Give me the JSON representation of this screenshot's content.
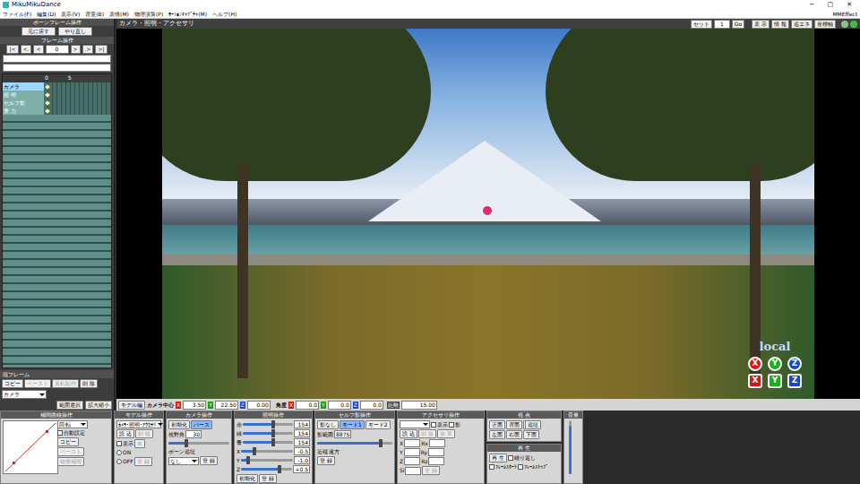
{
  "window": {
    "title": "MikuMikuDance",
    "controls": [
      "─",
      "▢",
      "✕"
    ]
  },
  "menu": {
    "items": [
      "ファイル(F)",
      "編集(D)",
      "表示(V)",
      "背景(B)",
      "表情(M)",
      "物理演算(P)",
      "ﾓｰｼｮﾝｷｬﾌﾟﾁｬ(M)",
      "ヘルプ(H)"
    ],
    "right": "MMEffect"
  },
  "frame_panel": {
    "title": "ボーンフレーム操作",
    "undo": "元に戻す",
    "redo": "やり直し",
    "nav_title": "フレーム操作",
    "nav": [
      "|<",
      "<.",
      "<"
    ],
    "frame": "0",
    "nav_next": [
      ">",
      ".>",
      ">|"
    ],
    "ruler": [
      "0",
      "5"
    ],
    "tracks": [
      {
        "name": "カメラ",
        "selected": true,
        "keyframe": true
      },
      {
        "name": "照 明",
        "selected": false,
        "keyframe": true
      },
      {
        "name": "セルフ影",
        "selected": false,
        "keyframe": true
      },
      {
        "name": "重 力",
        "selected": false,
        "keyframe": true
      }
    ],
    "current_frame": "現フレーム",
    "edit_buttons": [
      {
        "label": "コピー",
        "disabled": false
      },
      {
        "label": "ペースト",
        "disabled": true
      },
      {
        "label": "反転貼付",
        "disabled": true
      },
      {
        "label": "削 除",
        "disabled": false
      }
    ],
    "target": "カメラ",
    "range_buttons": [
      "範囲選択",
      "拡大縮小"
    ]
  },
  "viewport": {
    "title": "カメラ・照明・アクセサリ",
    "set_label": "セット",
    "set_value": "1",
    "go": "Go",
    "tools": [
      "表 示",
      "情 報",
      "追エネ",
      "座標軸"
    ],
    "axis_mode": "local",
    "axis_rows": [
      {
        "kind": "rotate",
        "axes": [
          {
            "label": "X",
            "color": "#d01818"
          },
          {
            "label": "Y",
            "color": "#18b018"
          },
          {
            "label": "Z",
            "color": "#1848d0"
          }
        ]
      },
      {
        "kind": "move",
        "axes": [
          {
            "label": "X",
            "color": "#d01818"
          },
          {
            "label": "Y",
            "color": "#18b018"
          },
          {
            "label": "Z",
            "color": "#1848d0"
          }
        ]
      }
    ]
  },
  "status": {
    "mode": "モデル編",
    "center_label": "カメラ中心",
    "center": [
      {
        "axis": "X",
        "value": "3.50",
        "color": "#d01818"
      },
      {
        "axis": "Y",
        "value": "22.50",
        "color": "#18a018"
      },
      {
        "axis": "Z",
        "value": "0.00",
        "color": "#1848d0"
      }
    ],
    "angle_label": "角度",
    "angle": [
      {
        "axis": "X",
        "value": "0.0",
        "color": "#d01818"
      },
      {
        "axis": "Y",
        "value": "0.0",
        "color": "#18a018"
      },
      {
        "axis": "Z",
        "value": "0.0",
        "color": "#1848d0"
      }
    ],
    "distance_label": "距離",
    "distance": "15.00"
  },
  "panels": [
    {
      "title": "補間曲線操作",
      "columns": [
        [
          [
            {
              "kind": "curve"
            }
          ]
        ],
        [
          [
            {
              "kind": "select",
              "text": "回 転"
            }
          ],
          [
            {
              "kind": "check",
              "text": "自動設定",
              "checked": false
            }
          ],
          [
            {
              "kind": "button",
              "text": "コピー",
              "disabled": false
            }
          ],
          [
            {
              "kind": "button",
              "text": "ペースト",
              "disabled": true
            }
          ],
          [
            {
              "kind": "button",
              "text": "線形補間",
              "disabled": true
            }
          ]
        ]
      ]
    },
    {
      "title": "モデル操作",
      "columns": [
        [
          [
            {
              "kind": "select",
              "text": "ｶﾒﾗ･照明･ｱｸｾｻﾘ"
            }
          ],
          [
            {
              "kind": "button",
              "text": "読 込",
              "disabled": false
            },
            {
              "kind": "button",
              "text": "削 除",
              "disabled": true
            }
          ],
          [
            {
              "kind": "check",
              "text": "表示",
              "checked": false
            },
            {
              "kind": "button",
              "text": "IK",
              "disabled": true
            }
          ],
          [
            {
              "kind": "radio",
              "text": "ON",
              "selected": false
            }
          ],
          [
            {
              "kind": "radio",
              "text": "OFF",
              "selected": false
            },
            {
              "kind": "button",
              "text": "登 録",
              "disabled": true
            }
          ]
        ]
      ]
    },
    {
      "title": "カメラ操作",
      "columns": [
        [
          [
            {
              "kind": "button",
              "text": "初期化",
              "selected": false
            },
            {
              "kind": "button",
              "text": "パース",
              "selected": true
            }
          ],
          [
            {
              "kind": "label",
              "text": "視野角"
            },
            {
              "kind": "field",
              "text": "30"
            }
          ],
          [
            {
              "kind": "slider",
              "level": 0.3
            }
          ],
          [
            {
              "kind": "label",
              "text": "ボーン追従"
            }
          ],
          [
            {
              "kind": "select",
              "text": "なし"
            },
            {
              "kind": "button",
              "text": "登 録",
              "disabled": false
            }
          ]
        ]
      ]
    },
    {
      "title": "照明操作",
      "columns": [
        [
          [
            {
              "kind": "label",
              "text": "赤"
            },
            {
              "kind": "slider",
              "level": 0.6
            },
            {
              "kind": "field",
              "text": "154"
            }
          ],
          [
            {
              "kind": "label",
              "text": "緑"
            },
            {
              "kind": "slider",
              "level": 0.6
            },
            {
              "kind": "field",
              "text": "154"
            }
          ],
          [
            {
              "kind": "label",
              "text": "青"
            },
            {
              "kind": "slider",
              "level": 0.6
            },
            {
              "kind": "field",
              "text": "154"
            }
          ],
          [
            {
              "kind": "label",
              "text": "X"
            },
            {
              "kind": "slider",
              "level": 0.25
            },
            {
              "kind": "field",
              "text": "-0.5"
            }
          ],
          [
            {
              "kind": "label",
              "text": "Y"
            },
            {
              "kind": "slider",
              "level": 0.15
            },
            {
              "kind": "field",
              "text": "-1.0"
            }
          ],
          [
            {
              "kind": "label",
              "text": "Z"
            },
            {
              "kind": "slider",
              "level": 0.75
            },
            {
              "kind": "field",
              "text": "+0.5"
            }
          ],
          [
            {
              "kind": "button",
              "text": "初期化",
              "disabled": false
            },
            {
              "kind": "button",
              "text": "登 録",
              "disabled": false
            }
          ]
        ]
      ]
    },
    {
      "title": "セルフ影操作",
      "columns": [
        [
          [
            {
              "kind": "button",
              "text": "影なし",
              "selected": false
            },
            {
              "kind": "button",
              "text": "モード1",
              "selected": true
            },
            {
              "kind": "button",
              "text": "モード2",
              "selected": false
            }
          ],
          [
            {
              "kind": "label",
              "text": "影範囲"
            },
            {
              "kind": "field",
              "text": "8875"
            }
          ],
          [
            {
              "kind": "slider",
              "level": 0.85
            }
          ],
          [
            {
              "kind": "label",
              "text": "近端"
            },
            {
              "kind": "label",
              "text": "遠方"
            }
          ],
          [
            {
              "kind": "button",
              "text": "登 録",
              "disabled": false
            }
          ]
        ]
      ]
    },
    {
      "title": "アクセサリ操作",
      "columns": [
        [
          [
            {
              "kind": "select",
              "text": ""
            },
            {
              "kind": "check",
              "text": "表示",
              "checked": false
            },
            {
              "kind": "check",
              "text": "影",
              "checked": false
            }
          ],
          [
            {
              "kind": "button",
              "text": "読 込",
              "disabled": false
            },
            {
              "kind": "button",
              "text": "削 除",
              "disabled": true
            },
            {
              "kind": "button",
              "text": "加 算",
              "disabled": true
            }
          ],
          [
            {
              "kind": "label",
              "text": "X"
            },
            {
              "kind": "field",
              "text": ""
            },
            {
              "kind": "label",
              "text": "Rx"
            },
            {
              "kind": "field",
              "text": ""
            }
          ],
          [
            {
              "kind": "label",
              "text": "Y"
            },
            {
              "kind": "field",
              "text": ""
            },
            {
              "kind": "label",
              "text": "Ry"
            },
            {
              "kind": "field",
              "text": ""
            }
          ],
          [
            {
              "kind": "label",
              "text": "Z"
            },
            {
              "kind": "field",
              "text": ""
            },
            {
              "kind": "label",
              "text": "Rz"
            },
            {
              "kind": "field",
              "text": ""
            }
          ],
          [
            {
              "kind": "label",
              "text": "Si"
            },
            {
              "kind": "field",
              "text": ""
            },
            {
              "kind": "button",
              "text": "登 録",
              "disabled": true
            }
          ]
        ]
      ]
    },
    {
      "title": "視 点",
      "columns": [
        [
          [
            {
              "kind": "button",
              "text": "正面",
              "disabled": false
            },
            {
              "kind": "button",
              "text": "背面",
              "disabled": false
            },
            {
              "kind": "button",
              "text": "上面",
              "disabled": false
            }
          ],
          [
            {
              "kind": "button",
              "text": "左面",
              "disabled": false
            },
            {
              "kind": "button",
              "text": "右面",
              "disabled": false
            },
            {
              "kind": "button",
              "text": "下面",
              "disabled": false
            }
          ]
        ],
        [
          [
            {
              "kind": "button",
              "text": "追従",
              "disabled": false
            }
          ]
        ]
      ]
    },
    {
      "title": "再 生",
      "columns": [
        [
          [
            {
              "kind": "button",
              "text": "再 生",
              "disabled": false
            },
            {
              "kind": "check",
              "text": "繰り返し",
              "checked": false
            }
          ],
          [
            {
              "kind": "check",
              "text": "ﾌﾚｰﾑｽﾀｰﾄ",
              "checked": false
            },
            {
              "kind": "check",
              "text": "ﾌﾚｰﾑｽﾄｯﾌﾟ",
              "checked": false
            }
          ]
        ]
      ]
    },
    {
      "title": "音量",
      "columns": [
        [
          [
            {
              "kind": "vslider",
              "level": 0.9
            }
          ]
        ]
      ]
    }
  ]
}
